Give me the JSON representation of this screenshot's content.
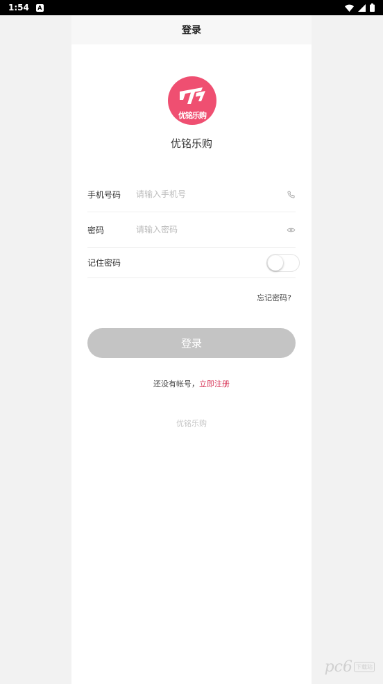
{
  "status_bar": {
    "time": "1:54",
    "app_badge": "A",
    "icons": [
      "wifi-icon",
      "signal-icon",
      "battery-icon"
    ]
  },
  "header": {
    "title": "登录"
  },
  "brand": {
    "logo_text": "优铭乐购",
    "app_name": "优铭乐购",
    "accent_color": "#ef4f71"
  },
  "form": {
    "phone": {
      "label": "手机号码",
      "placeholder": "请输入手机号",
      "icon": "phone-icon"
    },
    "password": {
      "label": "密码",
      "placeholder": "请输入密码",
      "icon": "eye-icon"
    },
    "remember": {
      "label": "记住密码",
      "enabled": false
    }
  },
  "forgot_password": "忘记密码?",
  "login_button": "登录",
  "register": {
    "prompt": "还没有帐号，",
    "link": "立即注册",
    "link_color": "#d8385a"
  },
  "footer": {
    "app_name": "优铭乐购"
  },
  "watermark": {
    "mark": "pc6",
    "sub": "下载站"
  }
}
